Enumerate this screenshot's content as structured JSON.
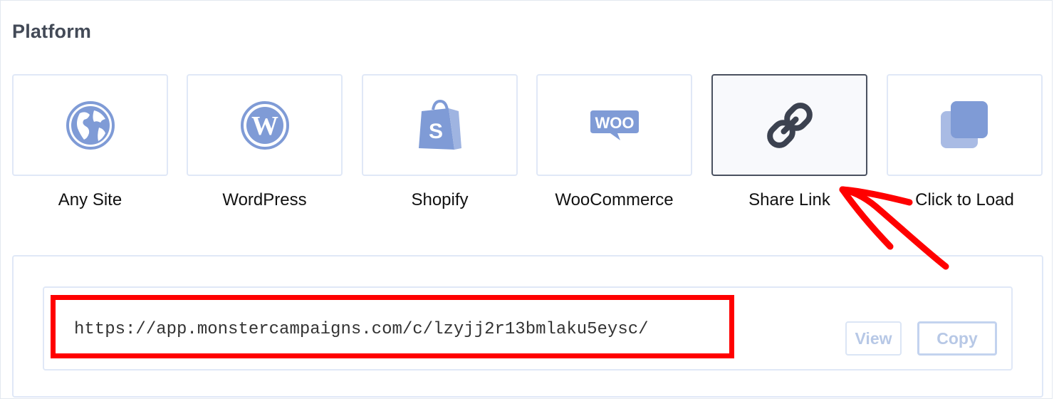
{
  "section": {
    "title": "Platform"
  },
  "platforms": [
    {
      "label": "Any Site",
      "icon": "globe-icon",
      "selected": false
    },
    {
      "label": "WordPress",
      "icon": "wordpress-icon",
      "selected": false
    },
    {
      "label": "Shopify",
      "icon": "shopify-bag-icon",
      "selected": false
    },
    {
      "label": "WooCommerce",
      "icon": "woo-icon",
      "selected": false
    },
    {
      "label": "Share Link",
      "icon": "chain-link-icon",
      "selected": true
    },
    {
      "label": "Click to Load",
      "icon": "copy-layers-icon",
      "selected": false
    }
  ],
  "share_link": {
    "url": "https://app.monstercampaigns.com/c/lzyjj2r13bmlaku5eysc/",
    "view_label": "View",
    "copy_label": "Copy"
  },
  "colors": {
    "icon": "#7f9bd6",
    "selected_icon": "#3c4250",
    "selected_border": "#4a5160",
    "tile_border": "#e0e8f7",
    "button_text": "#b7c8e6",
    "annotation": "#ff0000"
  }
}
